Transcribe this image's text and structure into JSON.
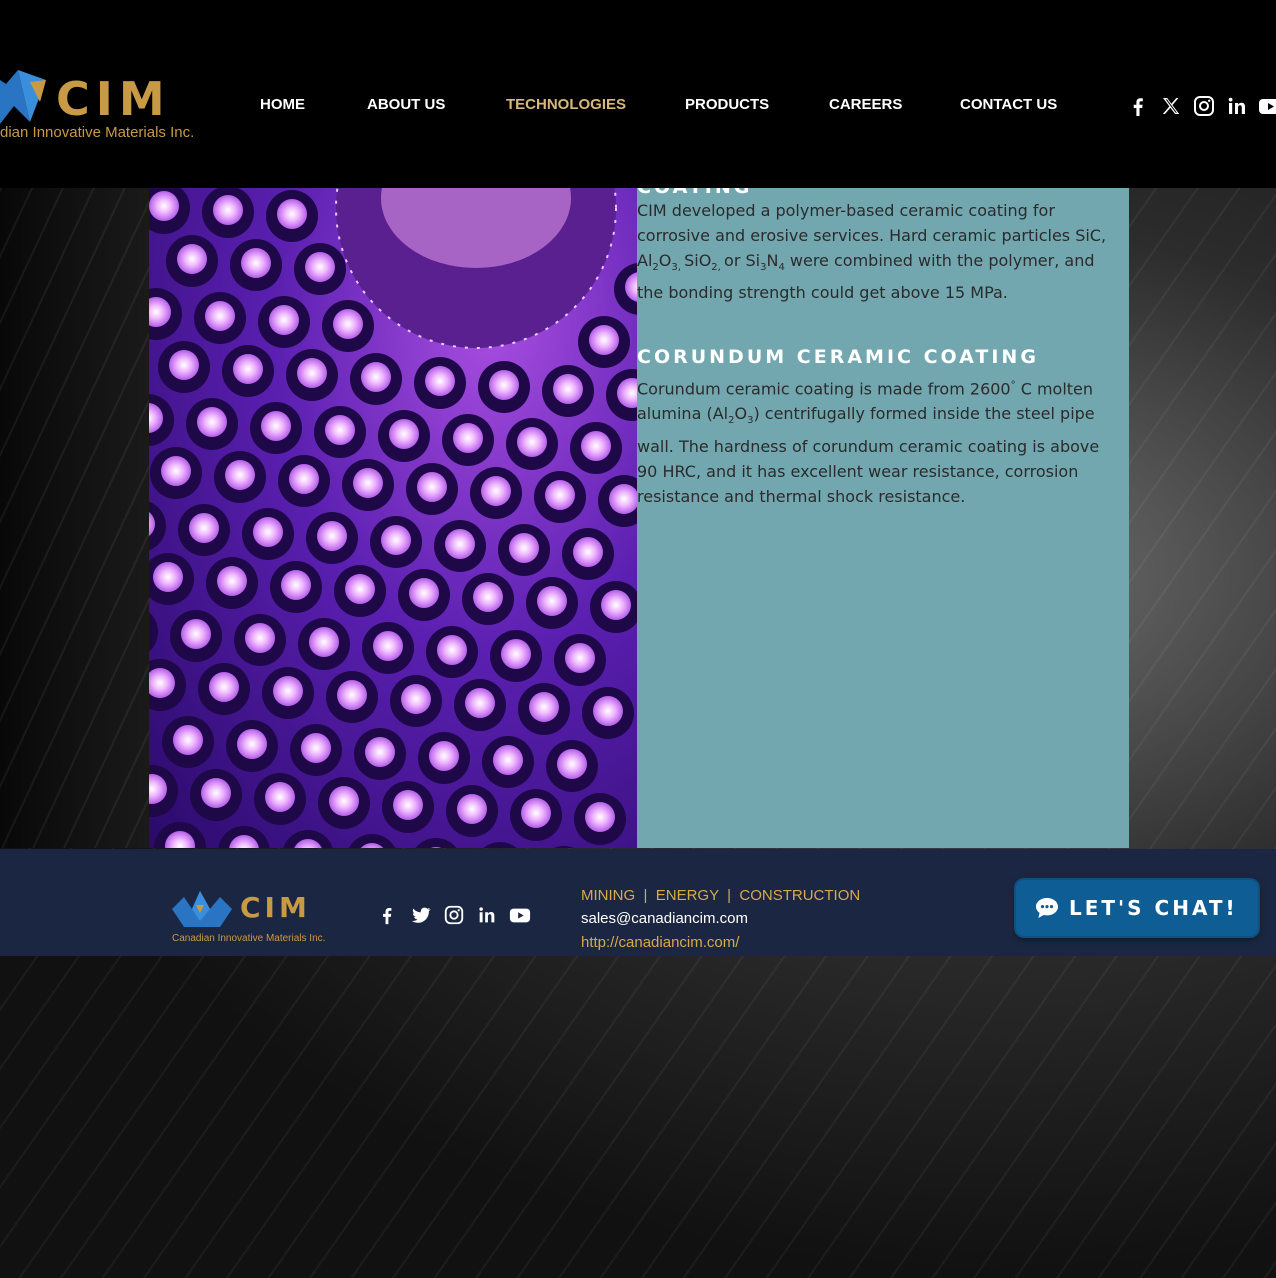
{
  "header": {
    "logo": {
      "wordmark": "CIM",
      "tagline": "dian Innovative Materials Inc."
    },
    "nav": [
      {
        "label": "HOME"
      },
      {
        "label": "ABOUT US"
      },
      {
        "label": "TECHNOLOGIES",
        "active": true
      },
      {
        "label": "PRODUCTS"
      },
      {
        "label": "CAREERS"
      },
      {
        "label": "CONTACT US"
      }
    ],
    "social_icons": [
      "facebook-icon",
      "x-icon",
      "instagram-icon",
      "linkedin-icon",
      "youtube-icon"
    ]
  },
  "content": {
    "cut_heading": "COATING",
    "para1": {
      "part_a": "CIM developed a polymer-based ceramic coating for corrosive and erosive services. Hard ceramic particles SiC, Al",
      "sub_1": "2",
      "part_b": "O",
      "sub_2": "3, ",
      "part_c": "SiO",
      "sub_3": "2, ",
      "part_d": "or Si",
      "sub_4": "3",
      "part_e": "N",
      "sub_5": "4",
      "part_f": " were combined with the polymer, and the bonding strength could get above 15 MPa."
    },
    "heading2": "CORUNDUM CERAMIC COATING",
    "para2": {
      "part_a": "Corundum ceramic coating is made from 2600",
      "sup_1": "°",
      "part_b": " C molten alumina (Al",
      "sub_1": "2",
      "part_c": "O",
      "sub_2": "3",
      "part_d": ") centrifugally formed inside the steel pipe wall. The hardness of corundum ceramic coating is above 90 HRC, and it has excellent wear resistance, corrosion resistance and thermal shock resistance."
    }
  },
  "footer": {
    "logo": {
      "wordmark": "CIM",
      "tagline": "Canadian Innovative Materials Inc."
    },
    "tagline": "MINING  |  ENERGY  |  CONSTRUCTION",
    "email": "sales@canadiancim.com",
    "url": "http://canadiancim.com/",
    "social_icons": [
      "facebook-icon",
      "twitter-icon",
      "instagram-icon",
      "linkedin-icon",
      "youtube-icon"
    ]
  },
  "chat": {
    "label": "LET'S CHAT!"
  },
  "colors": {
    "gold": "#c99a45",
    "nav_active": "#d9b777",
    "panel": "#72a7b0",
    "footer_bg": "#1b2742",
    "chat_bg": "#0f5d95"
  }
}
